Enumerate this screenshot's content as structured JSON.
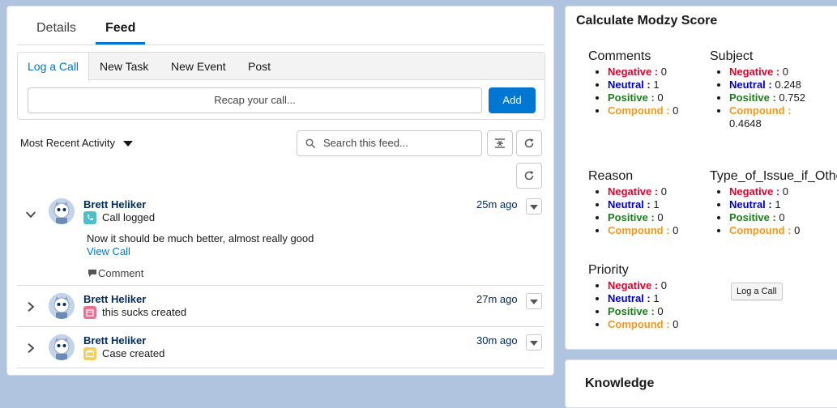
{
  "feed_panel": {
    "tabs": [
      {
        "label": "Details"
      },
      {
        "label": "Feed"
      }
    ],
    "publisher": {
      "tabs": [
        {
          "label": "Log a Call"
        },
        {
          "label": "New Task"
        },
        {
          "label": "New Event"
        },
        {
          "label": "Post"
        }
      ],
      "recap_placeholder": "Recap your call...",
      "add_label": "Add"
    },
    "sort_label": "Most Recent Activity",
    "search_placeholder": "Search this feed...",
    "items": [
      {
        "author": "Brett Heliker",
        "type_text": "Call logged",
        "time": "25m ago",
        "body": "Now it should be much better, almost really good",
        "link": "View Call",
        "comment": "Comment",
        "icon": "call-icon",
        "icon_color": "#4bc0c8"
      },
      {
        "author": "Brett Heliker",
        "type_text": "this sucks created",
        "time": "27m ago",
        "icon": "event-icon",
        "icon_color": "#eb7092"
      },
      {
        "author": "Brett Heliker",
        "type_text": "Case created",
        "time": "30m ago",
        "icon": "case-icon",
        "icon_color": "#f2cf5b"
      }
    ]
  },
  "modzy": {
    "title": "Calculate Modzy Score",
    "labels": {
      "negative": "Negative :",
      "neutral": "Neutral :",
      "positive": "Positive :",
      "compound": "Compound :"
    },
    "metrics": [
      {
        "name": "Comments",
        "negative": "0",
        "neutral": "1",
        "positive": "0",
        "compound": "0"
      },
      {
        "name": "Subject",
        "negative": "0",
        "neutral": "0.248",
        "positive": "0.752",
        "compound": "0.4648"
      },
      {
        "name": "Reason",
        "negative": "0",
        "neutral": "1",
        "positive": "0",
        "compound": "0"
      },
      {
        "name": "Type_of_Issue_if_Other",
        "negative": "0",
        "neutral": "1",
        "positive": "0",
        "compound": "0"
      },
      {
        "name": "Priority",
        "negative": "0",
        "neutral": "1",
        "positive": "0",
        "compound": "0"
      }
    ],
    "log_call_label": "Log a Call"
  },
  "knowledge": {
    "title": "Knowledge"
  },
  "colors": {
    "accent": "#0176d3",
    "negative": "#e4002b",
    "neutral": "#0000cc",
    "positive": "#1a7f1a",
    "compound": "#f39820"
  }
}
